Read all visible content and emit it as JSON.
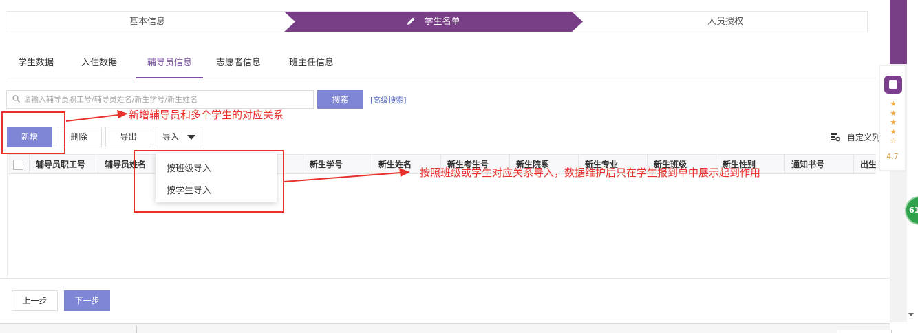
{
  "steps": {
    "items": [
      {
        "label": "基本信息"
      },
      {
        "label": "学生名单"
      },
      {
        "label": "人员授权"
      }
    ],
    "active_index": 1
  },
  "tabs": [
    {
      "label": "学生数据"
    },
    {
      "label": "入住数据"
    },
    {
      "label": "辅导员信息"
    },
    {
      "label": "志愿者信息"
    },
    {
      "label": "班主任信息"
    }
  ],
  "active_tab": 2,
  "search": {
    "placeholder": "请输入辅导员职工号/辅导员姓名/新生学号/新生姓名",
    "value": "",
    "button_label": "搜索",
    "advanced_label": "[高级搜索]"
  },
  "toolbar": {
    "new_label": "新增",
    "delete_label": "删除",
    "export_label": "导出",
    "import_label": "导入",
    "custom_columns_label": "自定义列"
  },
  "table": {
    "columns": [
      "辅导员职工号",
      "辅导员姓名",
      "",
      "新生学号",
      "新生姓名",
      "新生考生号",
      "新生院系",
      "新生专业",
      "新生班级",
      "新生性别",
      "通知书号",
      "出生"
    ],
    "rows": []
  },
  "import_menu": {
    "items": [
      "按班级导入",
      "按学生导入"
    ]
  },
  "footer": {
    "prev_label": "上一步",
    "next_label": "下一步"
  },
  "rating_widget": {
    "score": "4.7",
    "stars": 4.5
  },
  "floating_badge": "61",
  "annotations": {
    "new_note": "新增辅导员和多个学生的对应关系",
    "import_note": "按照班级或学生对应关系导入，数据维护后只在学生报到单中展示起到作用"
  },
  "colors": {
    "brand": "#783f86",
    "primary_button": "#7f86d6",
    "annotation": "#e8312d",
    "link": "#5b6bc0",
    "star": "#f0a73b"
  }
}
